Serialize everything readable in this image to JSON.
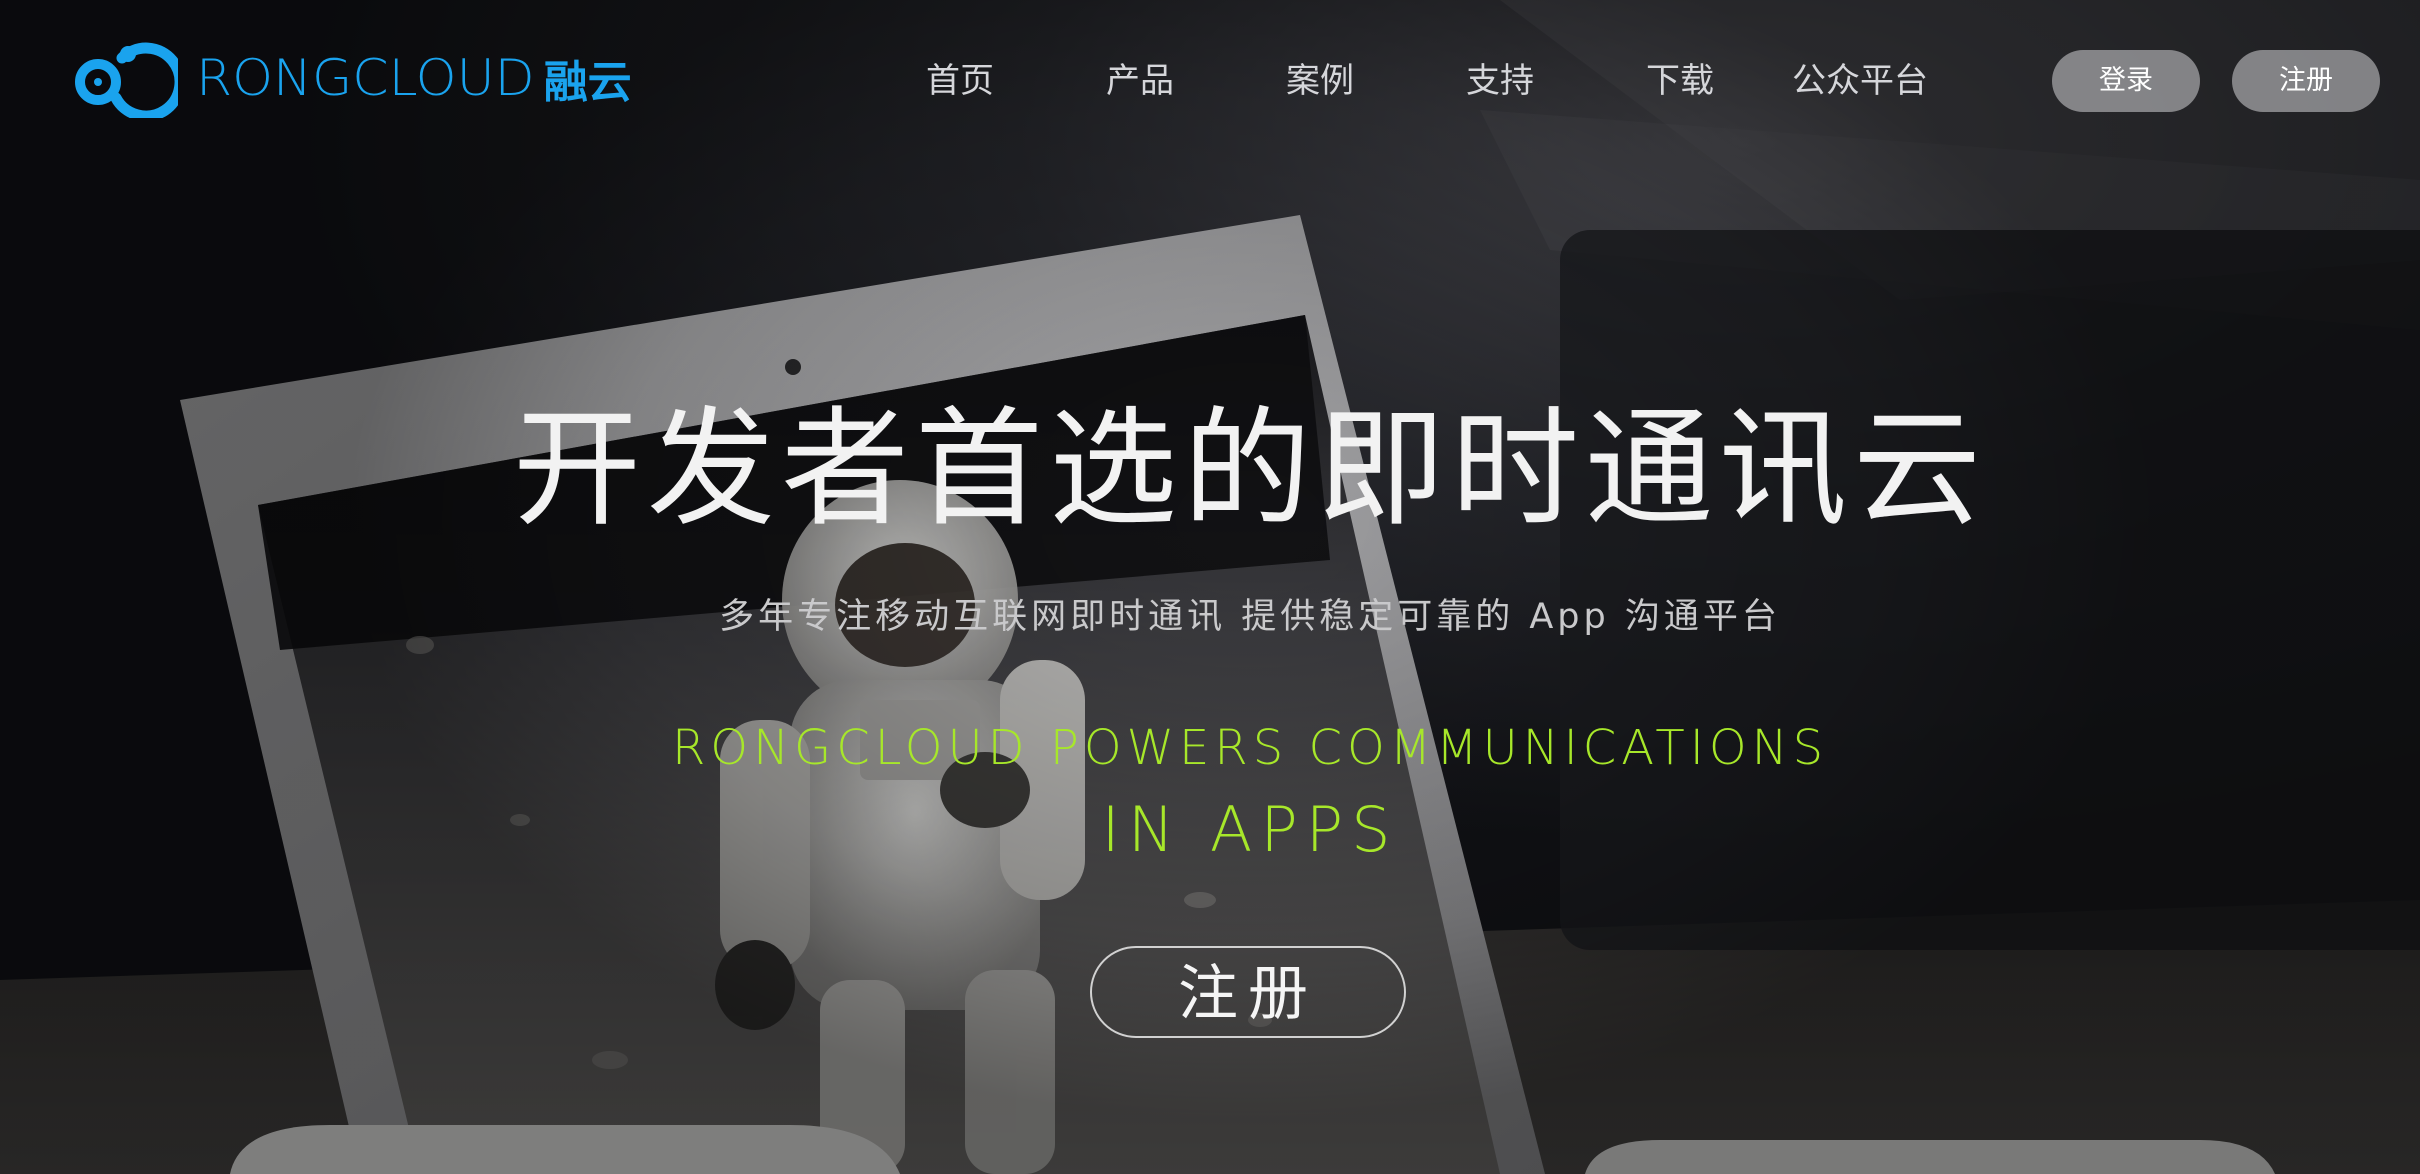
{
  "brand": {
    "logo_text": "RONGCLOUD",
    "logo_cn": "融云",
    "accent": "#1aa3ee",
    "logo_icon": "rongcloud-logo-icon"
  },
  "nav": {
    "items": [
      {
        "label": "首页"
      },
      {
        "label": "产品"
      },
      {
        "label": "案例"
      },
      {
        "label": "支持"
      },
      {
        "label": "下载"
      },
      {
        "label": "公众平台"
      }
    ]
  },
  "auth": {
    "login_label": "登录",
    "register_label": "注册"
  },
  "hero": {
    "title": "开发者首选的即时通讯云",
    "subtitle": "多年专注移动互联网即时通讯 提供稳定可靠的 App 沟通平台",
    "tagline_1": "RONGCLOUD POWERS COMMUNICATIONS",
    "tagline_2": "IN APPS",
    "tagline_color": "#a7e72a",
    "cta_label": "注册"
  }
}
